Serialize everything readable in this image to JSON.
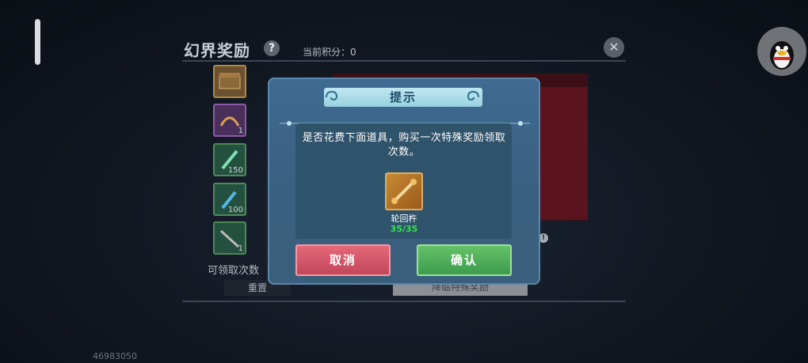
{
  "background": {
    "panel_title": "幻界奖励",
    "help_icon": "?",
    "score_label": "当前积分：",
    "score_value": "0",
    "close_icon": "✕",
    "slots": [
      {
        "count": ""
      },
      {
        "count": "1"
      },
      {
        "count": "150"
      },
      {
        "count": "100"
      },
      {
        "count": "1"
      }
    ],
    "claim_label": "可领取次数",
    "reset_label": "重置",
    "gold_button_label": "降临特殊奖励",
    "id_number": "46983050"
  },
  "dialog": {
    "title": "提示",
    "message": "是否花费下面道具，购买一次特殊奖励领取次数。",
    "item": {
      "name": "轮回杵",
      "count": "35/35"
    },
    "cancel_label": "取消",
    "confirm_label": "确认"
  },
  "colors": {
    "cancel": "#d65468",
    "confirm": "#4fb059",
    "count_green": "#39e054",
    "modal_bg": "#3c6585"
  }
}
